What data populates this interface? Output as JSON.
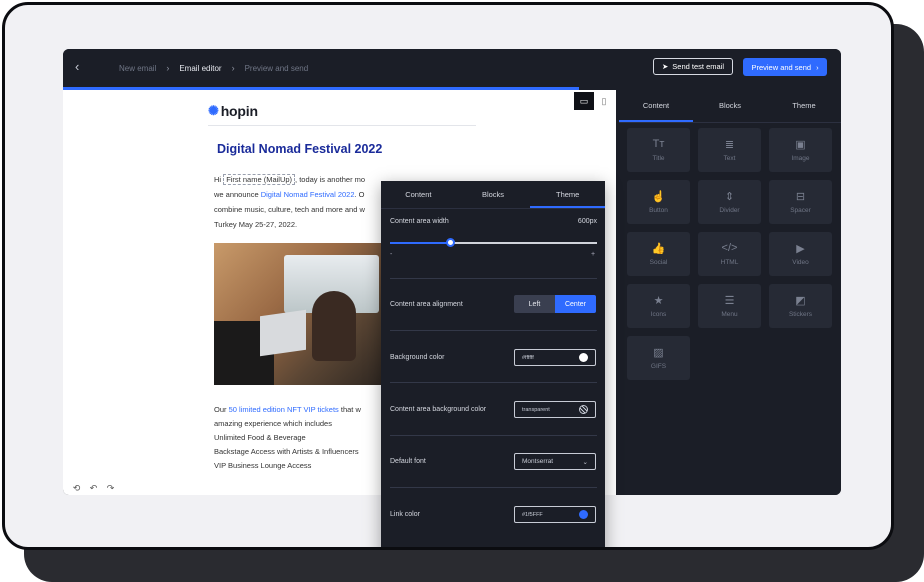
{
  "breadcrumbs": [
    {
      "label": "New email",
      "active": false
    },
    {
      "label": "Email editor",
      "active": true
    },
    {
      "label": "Preview and send",
      "active": false
    }
  ],
  "topbar": {
    "send_test_label": "Send test email",
    "preview_label": "Preview and send"
  },
  "email": {
    "logo_text": "hopin",
    "headline": "Digital Nomad Festival 2022",
    "intro_pre": "Hi",
    "merge_tag": "First name (MailUp)",
    "intro_mid": ", today is another mo",
    "intro_line2_pre": "we announce",
    "intro_link": "Digital Nomad Festival 2022",
    "intro_line2_post": ". O",
    "intro_line3": "combine music, culture, tech and more and w",
    "intro_line4": "Turkey May 25-27, 2022.",
    "body_pre": "Our",
    "body_link": "50 limited edition NFT VIP tickets",
    "body_post": " that w",
    "body_line2": "amazing experience which includes",
    "body_line3": "Unlimited Food & Beverage",
    "body_line4": "Backstage Access with Artists & Influencers",
    "body_line5": "VIP Business Lounge Access"
  },
  "theme_panel": {
    "tabs": [
      "Content",
      "Blocks",
      "Theme"
    ],
    "active_tab": "Theme",
    "content_width_label": "Content area width",
    "content_width_value": "600px",
    "slider_fraction": 0.29,
    "minus": "-",
    "plus": "+",
    "alignment_label": "Content area alignment",
    "align_left": "Left",
    "align_center": "Center",
    "background_label": "Background color",
    "background_value": "#ffffff",
    "background_swatch": "#ffffff",
    "content_bg_label": "Content area background color",
    "content_bg_value": "transparent",
    "font_label": "Default font",
    "font_value": "Montserrat",
    "link_label": "Link color",
    "link_value": "#1f5FFF",
    "link_swatch": "#2f6bff"
  },
  "sidebar": {
    "tabs": [
      "Content",
      "Blocks",
      "Theme"
    ],
    "active_tab": "Content",
    "tiles": [
      {
        "label": "Title",
        "icon": "title-icon",
        "glyph": "Tт"
      },
      {
        "label": "Text",
        "icon": "text-icon",
        "glyph": "≣"
      },
      {
        "label": "Image",
        "icon": "image-icon",
        "glyph": "▣"
      },
      {
        "label": "Button",
        "icon": "button-icon",
        "glyph": "☝"
      },
      {
        "label": "Divider",
        "icon": "divider-icon",
        "glyph": "⇕"
      },
      {
        "label": "Spacer",
        "icon": "spacer-icon",
        "glyph": "⊟"
      },
      {
        "label": "Social",
        "icon": "social-icon",
        "glyph": "👍"
      },
      {
        "label": "HTML",
        "icon": "html-icon",
        "glyph": "</>"
      },
      {
        "label": "Video",
        "icon": "video-icon",
        "glyph": "▶"
      },
      {
        "label": "Icons",
        "icon": "star-icon",
        "glyph": "★"
      },
      {
        "label": "Menu",
        "icon": "menu-icon",
        "glyph": "☰"
      },
      {
        "label": "Stickers",
        "icon": "sticker-icon",
        "glyph": "◩"
      },
      {
        "label": "GIFS",
        "icon": "gif-icon",
        "glyph": "▨"
      }
    ]
  },
  "colors": {
    "accent": "#2f6bff",
    "app_bg": "#1b1e27",
    "headline": "#1a2b9a"
  }
}
